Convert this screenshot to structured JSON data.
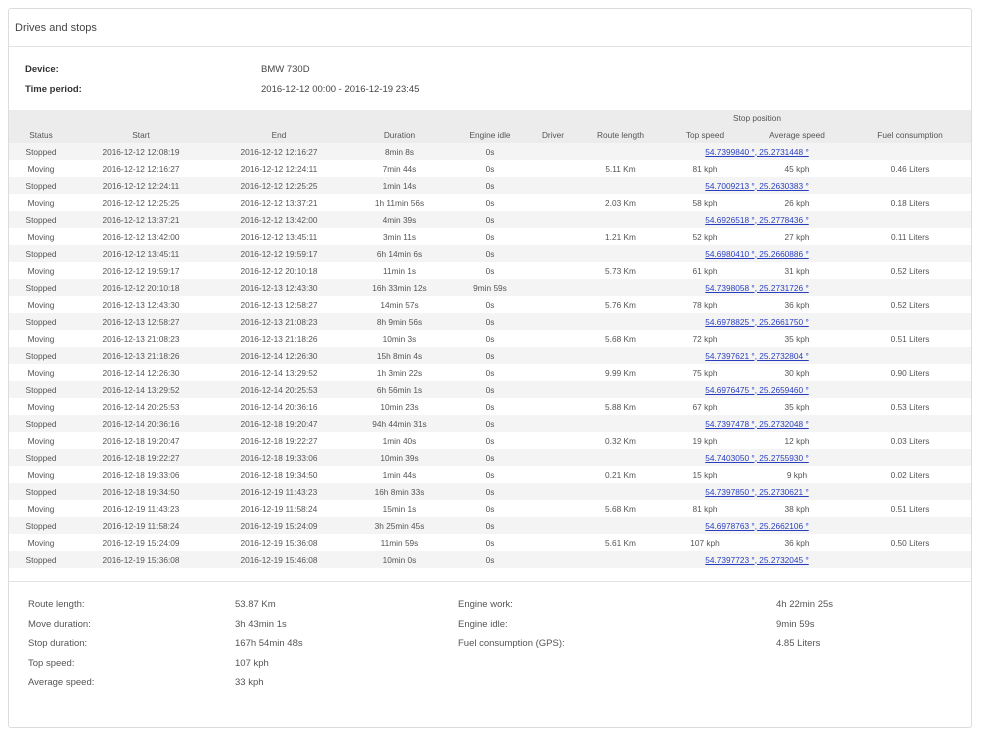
{
  "panel": {
    "title": "Drives and stops"
  },
  "info": {
    "device_label": "Device:",
    "device_value": "BMW 730D",
    "period_label": "Time period:",
    "period_value": "2016-12-12 00:00 - 2016-12-19 23:45"
  },
  "table": {
    "group_header": "Stop position",
    "columns": [
      "Status",
      "Start",
      "End",
      "Duration",
      "Engine idle",
      "Driver",
      "Route length",
      "Top speed",
      "Average speed",
      "Fuel consumption"
    ],
    "rows": [
      {
        "status": "Stopped",
        "start": "2016-12-12 12:08:19",
        "end": "2016-12-12 12:16:27",
        "duration": "8min 8s",
        "idle": "0s",
        "position": "54.7399840 °, 25.2731448 °"
      },
      {
        "status": "Moving",
        "start": "2016-12-12 12:16:27",
        "end": "2016-12-12 12:24:11",
        "duration": "7min 44s",
        "idle": "0s",
        "route": "5.11 Km",
        "top": "81 kph",
        "avg": "45 kph",
        "fuel": "0.46 Liters"
      },
      {
        "status": "Stopped",
        "start": "2016-12-12 12:24:11",
        "end": "2016-12-12 12:25:25",
        "duration": "1min 14s",
        "idle": "0s",
        "position": "54.7009213 °, 25.2630383 °"
      },
      {
        "status": "Moving",
        "start": "2016-12-12 12:25:25",
        "end": "2016-12-12 13:37:21",
        "duration": "1h 11min 56s",
        "idle": "0s",
        "route": "2.03 Km",
        "top": "58 kph",
        "avg": "26 kph",
        "fuel": "0.18 Liters"
      },
      {
        "status": "Stopped",
        "start": "2016-12-12 13:37:21",
        "end": "2016-12-12 13:42:00",
        "duration": "4min 39s",
        "idle": "0s",
        "position": "54.6926518 °, 25.2778436 °"
      },
      {
        "status": "Moving",
        "start": "2016-12-12 13:42:00",
        "end": "2016-12-12 13:45:11",
        "duration": "3min 11s",
        "idle": "0s",
        "route": "1.21 Km",
        "top": "52 kph",
        "avg": "27 kph",
        "fuel": "0.11 Liters"
      },
      {
        "status": "Stopped",
        "start": "2016-12-12 13:45:11",
        "end": "2016-12-12 19:59:17",
        "duration": "6h 14min 6s",
        "idle": "0s",
        "position": "54.6980410 °, 25.2660886 °"
      },
      {
        "status": "Moving",
        "start": "2016-12-12 19:59:17",
        "end": "2016-12-12 20:10:18",
        "duration": "11min 1s",
        "idle": "0s",
        "route": "5.73 Km",
        "top": "61 kph",
        "avg": "31 kph",
        "fuel": "0.52 Liters"
      },
      {
        "status": "Stopped",
        "start": "2016-12-12 20:10:18",
        "end": "2016-12-13 12:43:30",
        "duration": "16h 33min 12s",
        "idle": "9min 59s",
        "position": "54.7398058 °, 25.2731726 °"
      },
      {
        "status": "Moving",
        "start": "2016-12-13 12:43:30",
        "end": "2016-12-13 12:58:27",
        "duration": "14min 57s",
        "idle": "0s",
        "route": "5.76 Km",
        "top": "78 kph",
        "avg": "36 kph",
        "fuel": "0.52 Liters"
      },
      {
        "status": "Stopped",
        "start": "2016-12-13 12:58:27",
        "end": "2016-12-13 21:08:23",
        "duration": "8h 9min 56s",
        "idle": "0s",
        "position": "54.6978825 °, 25.2661750 °"
      },
      {
        "status": "Moving",
        "start": "2016-12-13 21:08:23",
        "end": "2016-12-13 21:18:26",
        "duration": "10min 3s",
        "idle": "0s",
        "route": "5.68 Km",
        "top": "72 kph",
        "avg": "35 kph",
        "fuel": "0.51 Liters"
      },
      {
        "status": "Stopped",
        "start": "2016-12-13 21:18:26",
        "end": "2016-12-14 12:26:30",
        "duration": "15h 8min 4s",
        "idle": "0s",
        "position": "54.7397621 °, 25.2732804 °"
      },
      {
        "status": "Moving",
        "start": "2016-12-14 12:26:30",
        "end": "2016-12-14 13:29:52",
        "duration": "1h 3min 22s",
        "idle": "0s",
        "route": "9.99 Km",
        "top": "75 kph",
        "avg": "30 kph",
        "fuel": "0.90 Liters"
      },
      {
        "status": "Stopped",
        "start": "2016-12-14 13:29:52",
        "end": "2016-12-14 20:25:53",
        "duration": "6h 56min 1s",
        "idle": "0s",
        "position": "54.6976475 °, 25.2659460 °"
      },
      {
        "status": "Moving",
        "start": "2016-12-14 20:25:53",
        "end": "2016-12-14 20:36:16",
        "duration": "10min 23s",
        "idle": "0s",
        "route": "5.88 Km",
        "top": "67 kph",
        "avg": "35 kph",
        "fuel": "0.53 Liters"
      },
      {
        "status": "Stopped",
        "start": "2016-12-14 20:36:16",
        "end": "2016-12-18 19:20:47",
        "duration": "94h 44min 31s",
        "idle": "0s",
        "position": "54.7397478 °, 25.2732048 °"
      },
      {
        "status": "Moving",
        "start": "2016-12-18 19:20:47",
        "end": "2016-12-18 19:22:27",
        "duration": "1min 40s",
        "idle": "0s",
        "route": "0.32 Km",
        "top": "19 kph",
        "avg": "12 kph",
        "fuel": "0.03 Liters"
      },
      {
        "status": "Stopped",
        "start": "2016-12-18 19:22:27",
        "end": "2016-12-18 19:33:06",
        "duration": "10min 39s",
        "idle": "0s",
        "position": "54.7403050 °, 25.2755930 °"
      },
      {
        "status": "Moving",
        "start": "2016-12-18 19:33:06",
        "end": "2016-12-18 19:34:50",
        "duration": "1min 44s",
        "idle": "0s",
        "route": "0.21 Km",
        "top": "15 kph",
        "avg": "9 kph",
        "fuel": "0.02 Liters"
      },
      {
        "status": "Stopped",
        "start": "2016-12-18 19:34:50",
        "end": "2016-12-19 11:43:23",
        "duration": "16h 8min 33s",
        "idle": "0s",
        "position": "54.7397850 °, 25.2730621 °"
      },
      {
        "status": "Moving",
        "start": "2016-12-19 11:43:23",
        "end": "2016-12-19 11:58:24",
        "duration": "15min 1s",
        "idle": "0s",
        "route": "5.68 Km",
        "top": "81 kph",
        "avg": "38 kph",
        "fuel": "0.51 Liters"
      },
      {
        "status": "Stopped",
        "start": "2016-12-19 11:58:24",
        "end": "2016-12-19 15:24:09",
        "duration": "3h 25min 45s",
        "idle": "0s",
        "position": "54.6978763 °, 25.2662106 °"
      },
      {
        "status": "Moving",
        "start": "2016-12-19 15:24:09",
        "end": "2016-12-19 15:36:08",
        "duration": "11min 59s",
        "idle": "0s",
        "route": "5.61 Km",
        "top": "107 kph",
        "avg": "36 kph",
        "fuel": "0.50 Liters"
      },
      {
        "status": "Stopped",
        "start": "2016-12-19 15:36:08",
        "end": "2016-12-19 15:46:08",
        "duration": "10min 0s",
        "idle": "0s",
        "position": "54.7397723 °, 25.2732045 °"
      }
    ]
  },
  "summary": {
    "left": [
      {
        "label": "Route length:",
        "value": "53.87 Km"
      },
      {
        "label": "Move duration:",
        "value": "3h 43min 1s"
      },
      {
        "label": "Stop duration:",
        "value": "167h 54min 48s"
      },
      {
        "label": "Top speed:",
        "value": "107 kph"
      },
      {
        "label": "Average speed:",
        "value": "33 kph"
      }
    ],
    "right": [
      {
        "label": "Engine work:",
        "value": "4h 22min 25s"
      },
      {
        "label": "Engine idle:",
        "value": "9min 59s"
      },
      {
        "label": "Fuel consumption (GPS):",
        "value": "4.85 Liters"
      }
    ]
  }
}
